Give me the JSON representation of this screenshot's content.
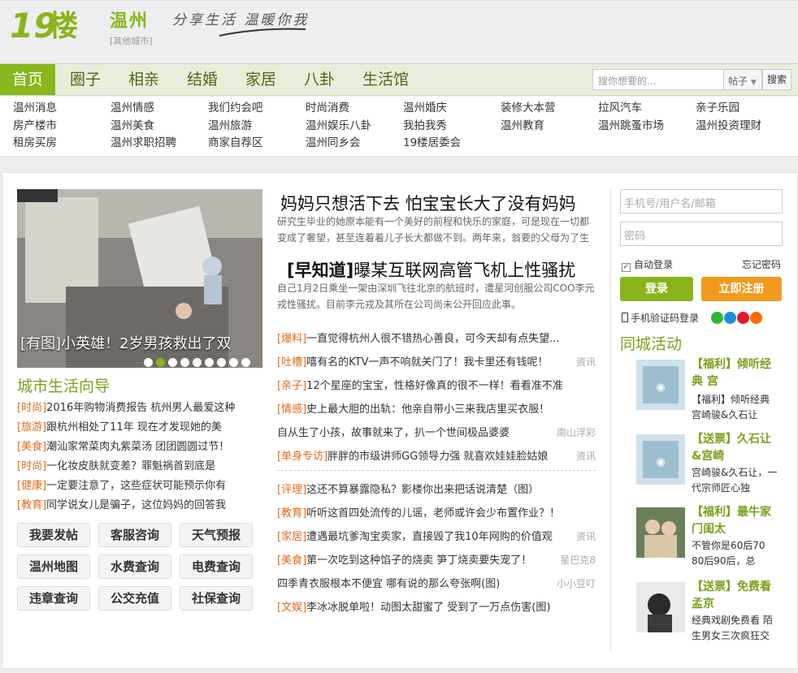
{
  "header": {
    "logo_text": "19楼",
    "city_name": "温州",
    "city_other": "[其他城市]",
    "slogan": "分享生活 温暖你我"
  },
  "nav": {
    "items": [
      "首页",
      "圈子",
      "相亲",
      "结婚",
      "家居",
      "八卦",
      "生活馆"
    ],
    "search_placeholder": "搜你想要的...",
    "search_type": "帖子",
    "search_button": "搜索"
  },
  "sublinks": [
    [
      "温州消息",
      "房产楼市",
      "租房买房"
    ],
    [
      "温州情感",
      "温州美食",
      "温州求职招聘"
    ],
    [
      "我们约会吧",
      "温州旅游",
      "商家自荐区"
    ],
    [
      "时尚消费",
      "温州娱乐八卦",
      "温州同乡会"
    ],
    [
      "温州婚庆",
      "我拍我秀",
      "19楼居委会"
    ],
    [
      "装修大本营",
      "温州教育"
    ],
    [
      "拉风汽车",
      "温州跳蚤市场"
    ],
    [
      "亲子乐园",
      "温州投资理财"
    ]
  ],
  "slider": {
    "caption": "[有图]小英雄！2岁男孩救出了双",
    "dots_total": 9,
    "active_dot": 2
  },
  "guide": {
    "title": "城市生活向导",
    "items": [
      {
        "tag": "[时尚]",
        "text": "2016年购物消费报告 杭州男人最爱这种"
      },
      {
        "tag": "[旅游]",
        "text": "跟杭州相处了11年 现在才发现她的美"
      },
      {
        "tag": "[美食]",
        "text": "潮汕家常菜肉丸紫菜汤 团团圆圆过节！"
      },
      {
        "tag": "[时尚]",
        "text": "一化妆皮肤就变差？罪魁祸首到底是"
      },
      {
        "tag": "[健康]",
        "text": "一定要注意了，这些症状可能预示你有"
      },
      {
        "tag": "[教育]",
        "text": "同学说女儿是骗子，这位妈妈的回答我"
      }
    ]
  },
  "quick_buttons": [
    "我要发帖",
    "客服咨询",
    "天气预报",
    "温州地图",
    "水费查询",
    "电费查询",
    "违章查询",
    "公交充值",
    "社保查询"
  ],
  "headlines": [
    {
      "title": "妈妈只想活下去 怕宝宝长大了没有妈妈",
      "summary": "研究生毕业的她原本能有一个美好的前程和快乐的家庭，可是现在一切都变成了奢望，甚至连着着儿子长大都做不到。两年来，翁要的父母为了生"
    },
    {
      "title_tag": "[早知道]",
      "title": "曝某互联网高管飞机上性骚扰",
      "summary": "自己1月2日乘坐一架由深圳飞往北京的航班时，遭星河创服公司COO李元戎性骚扰。目前李元戎及其所在公司尚未公开回应此事。"
    }
  ],
  "news_group1": [
    {
      "tag": "[爆料]",
      "text": "一直觉得杭州人很不错热心善良，可今天却有点失望...",
      "src": ""
    },
    {
      "tag": "[吐槽]",
      "text": "嘻有名的KTV一声不响就关门了！我卡里还有钱呢！",
      "src": "资讯"
    },
    {
      "tag": "[亲子]",
      "text": "12个星座的宝宝，性格好像真的很不一样！看看准不准",
      "src": ""
    },
    {
      "tag": "[情感]",
      "text": "史上最大胆的出轨：他亲自带小三来我店里买衣服！",
      "src": ""
    },
    {
      "tag": "",
      "text": "自从生了小孩，故事就来了，扒一个世间极品婆婆",
      "src": "南山浮彩"
    },
    {
      "tag": "[单身专访]",
      "text": "胖胖的市级讲师GG领导力强 就喜欢娃娃脸姑娘",
      "src": "资讯"
    }
  ],
  "news_group2": [
    {
      "tag": "[评理]",
      "text": "这还不算暴露隐私？影楼你出来把话说清楚（图）",
      "src": ""
    },
    {
      "tag": "[教育]",
      "text": "听听这首四处流传的儿谣，老师或许会少布置作业？！",
      "src": ""
    },
    {
      "tag": "[家居]",
      "text": "遭遇最坑爹淘宝卖家，直接毁了我10年网购的价值观",
      "src": "资讯"
    },
    {
      "tag": "[美食]",
      "text": "第一次吃到这种馅子的烧卖 笋丁烧卖要失宠了！",
      "src": "星巴克8"
    },
    {
      "tag": "",
      "text": "四季青衣服根本不便宜 哪有说的那么夸张啊(图)",
      "src": "小小豆叮"
    },
    {
      "tag": "[文娱]",
      "text": "李冰冰脱单啦！动图太甜蜜了 受到了一万点伤害(图)",
      "src": ""
    }
  ],
  "login": {
    "user_placeholder": "手机号/用户名/邮箱",
    "pass_placeholder": "密码",
    "remember": "自动登录",
    "forgot": "忘记密码",
    "login_button": "登录",
    "register_button": "立即注册",
    "sms_login": "手机验证码登录"
  },
  "activities": {
    "title": "同城活动",
    "items": [
      {
        "head": "【福利】倾听经典 宫",
        "desc": "【福利】倾听经典宫崎骏&久石让"
      },
      {
        "head": "【送票】久石让&宫崎",
        "desc": "宫崎骏&久石让，一代宗师匠心独"
      },
      {
        "head": "【福利】最牛家门闺太",
        "desc": "不管你是60后70 80后90后，总"
      },
      {
        "head": "【送票】免费看孟京",
        "desc": "经典戏剧免费看 陌生男女三次疯狂交"
      }
    ]
  },
  "colors": {
    "brand_green": "#8ab51a",
    "tag_orange": "#e06a1a",
    "register_orange": "#f29a1e",
    "nav_bg": "#e7eedc"
  }
}
